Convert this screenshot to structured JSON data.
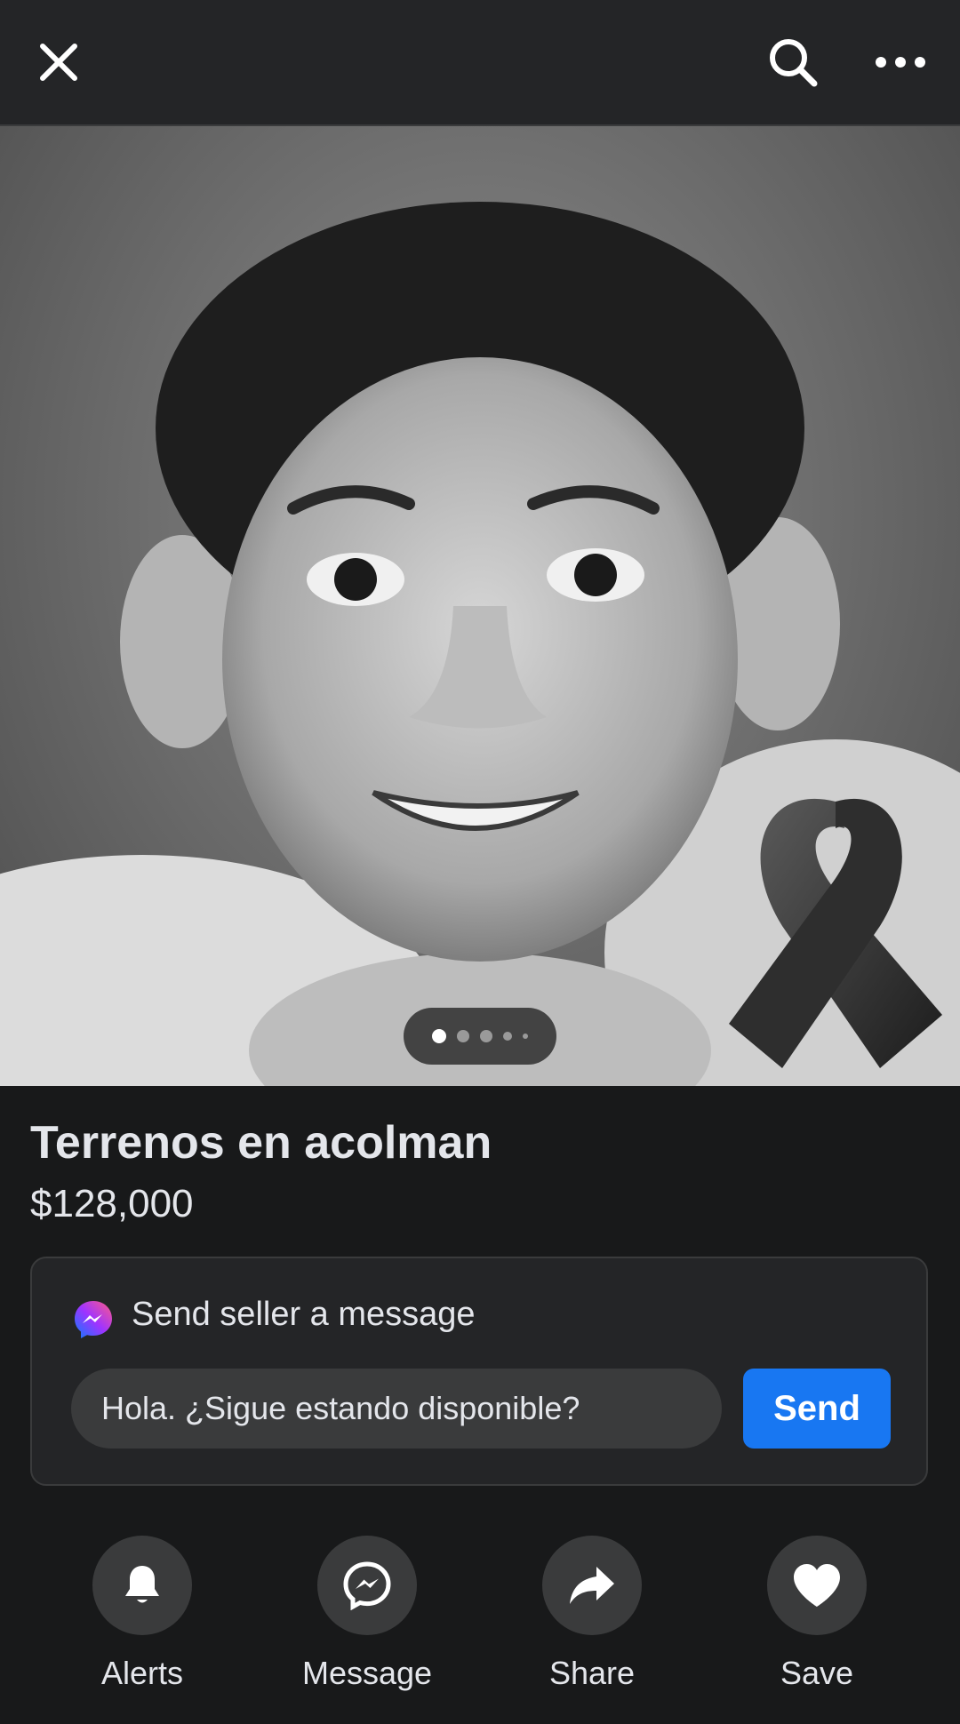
{
  "header": {
    "icons": [
      "close-icon",
      "search-icon",
      "more-icon"
    ]
  },
  "listing": {
    "photo_pages": 5,
    "current_photo": 1,
    "title": "Terrenos en acolman",
    "price": "$128,000"
  },
  "message_box": {
    "title": "Send seller a message",
    "input_value": "Hola. ¿Sigue estando disponible?",
    "send_label": "Send"
  },
  "actions": [
    {
      "label": "Alerts",
      "icon": "bell-icon"
    },
    {
      "label": "Message",
      "icon": "messenger-icon"
    },
    {
      "label": "Share",
      "icon": "share-arrow-icon"
    },
    {
      "label": "Save",
      "icon": "heart-icon"
    }
  ],
  "colors": {
    "background": "#18191a",
    "surface": "#242527",
    "accent": "#1877f2"
  }
}
